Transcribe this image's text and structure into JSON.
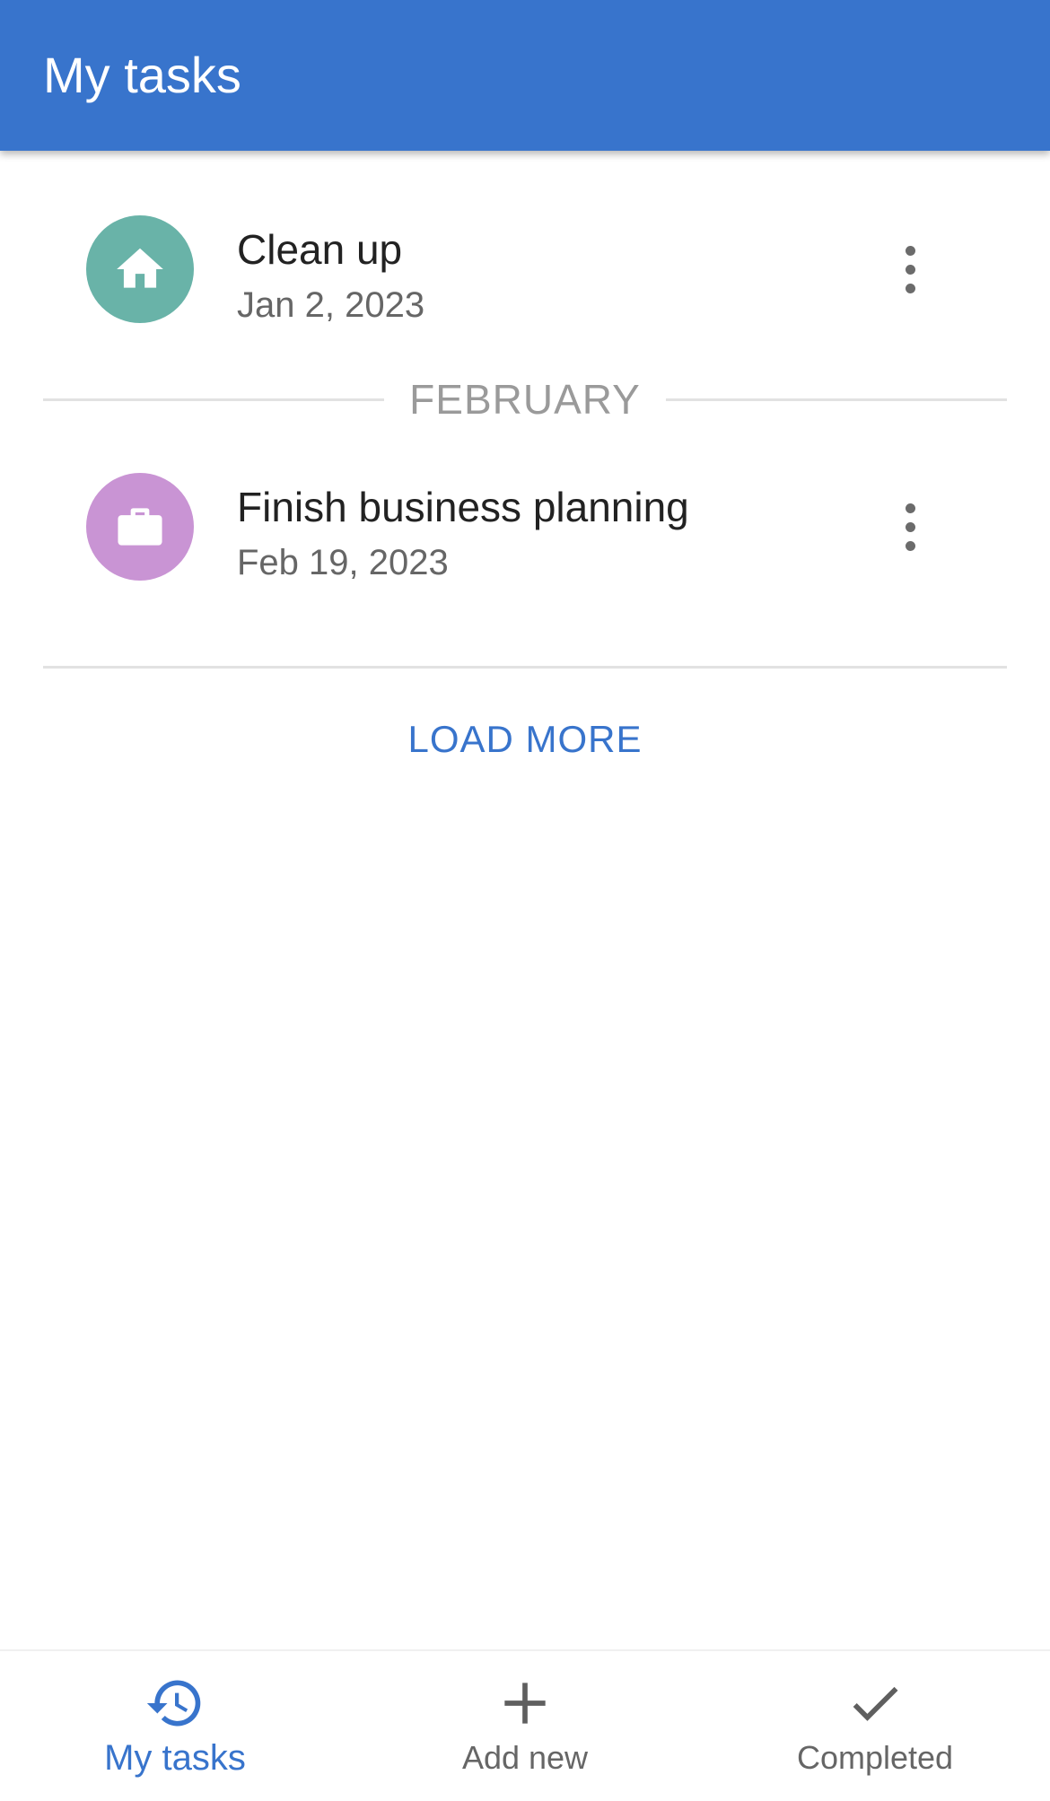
{
  "app_bar": {
    "title": "My tasks"
  },
  "colors": {
    "primary": "#3874cc",
    "home_avatar": "#69b3a8",
    "work_avatar": "#c994d4"
  },
  "tasks": [
    {
      "title": "Clean up",
      "date": "Jan 2, 2023",
      "icon": "home-icon"
    },
    {
      "title": "Finish business planning",
      "date": "Feb 19, 2023",
      "icon": "briefcase-icon"
    }
  ],
  "month_divider": {
    "label": "FEBRUARY"
  },
  "load_more": {
    "label": "LOAD MORE"
  },
  "bottom_nav": {
    "items": [
      {
        "label": "My tasks",
        "icon": "history-icon",
        "active": true
      },
      {
        "label": "Add new",
        "icon": "plus-icon",
        "active": false
      },
      {
        "label": "Completed",
        "icon": "check-icon",
        "active": false
      }
    ]
  }
}
